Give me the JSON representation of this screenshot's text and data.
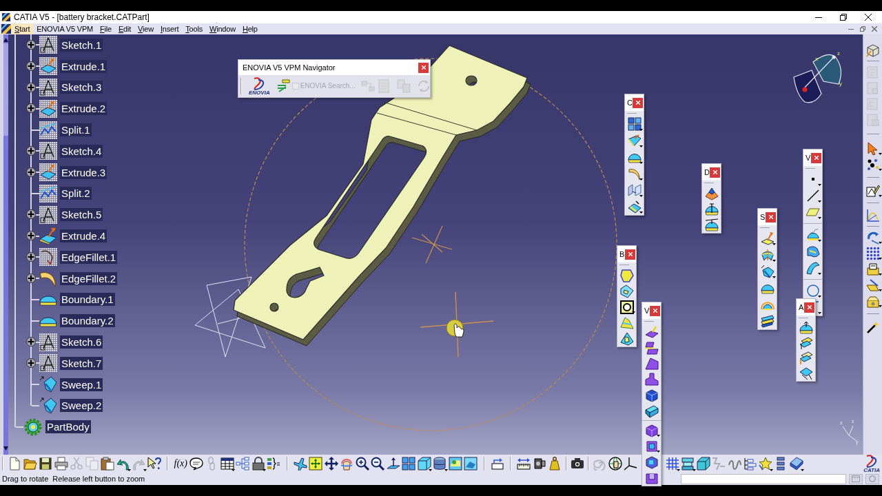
{
  "window": {
    "title": "CATIA V5 - [battery bracket.CATPart]"
  },
  "menu": [
    {
      "label": "Start",
      "selected": true,
      "mnemonic": true
    },
    {
      "label": "ENOVIA V5 VPM",
      "selected": false,
      "mnemonic": false
    },
    {
      "label": "File",
      "selected": false,
      "mnemonic": true
    },
    {
      "label": "Edit",
      "selected": false,
      "mnemonic": true
    },
    {
      "label": "View",
      "selected": false,
      "mnemonic": true
    },
    {
      "label": "Insert",
      "selected": false,
      "mnemonic": true
    },
    {
      "label": "Tools",
      "selected": false,
      "mnemonic": true
    },
    {
      "label": "Window",
      "selected": false,
      "mnemonic": true
    },
    {
      "label": "Help",
      "selected": false,
      "mnemonic": true
    }
  ],
  "tree": [
    {
      "children": [
        {
          "label": "Sketch.1",
          "kind": "sketch",
          "expanded": false
        },
        {
          "label": "Extrude.1",
          "kind": "extrude",
          "expanded": false
        },
        {
          "label": "Sketch.3",
          "kind": "sketch",
          "expanded": false
        },
        {
          "label": "Extrude.2",
          "kind": "extrude",
          "expanded": false
        },
        {
          "label": "Split.1",
          "kind": "split"
        },
        {
          "label": "Sketch.4",
          "kind": "sketch",
          "expanded": false
        },
        {
          "label": "Extrude.3",
          "kind": "extrude",
          "expanded": false
        },
        {
          "label": "Split.2",
          "kind": "split"
        },
        {
          "label": "Sketch.5",
          "kind": "sketch",
          "expanded": false
        },
        {
          "label": "Extrude.4",
          "kind": "extrude_slab",
          "expanded": false
        },
        {
          "label": "EdgeFillet.1",
          "kind": "edge_fillet",
          "expanded": false
        },
        {
          "label": "EdgeFillet.2",
          "kind": "fillet_crescent",
          "expanded": false
        },
        {
          "label": "Boundary.1",
          "kind": "boundary"
        },
        {
          "label": "Boundary.2",
          "kind": "boundary"
        },
        {
          "label": "Sketch.6",
          "kind": "sketch",
          "expanded": false
        },
        {
          "label": "Sketch.7",
          "kind": "sketch",
          "expanded": false
        },
        {
          "label": "Sweep.1",
          "kind": "sweep"
        },
        {
          "label": "Sweep.2",
          "kind": "sweep"
        }
      ]
    },
    {
      "label": "PartBody",
      "kind": "body"
    }
  ],
  "navigator": {
    "title": "ENOVIA V5 VPM Navigator",
    "logo": "ENOVIA",
    "search": {
      "label": "ENOVIA Search...",
      "checked": false,
      "disabled": true
    },
    "buttons": [
      {
        "disabled": false
      },
      {
        "disabled": true
      },
      {
        "disabled": true
      },
      {
        "disabled": true
      },
      {
        "disabled": true
      }
    ]
  },
  "palettes": [
    {
      "title": "C"
    },
    {
      "title": "V"
    },
    {
      "title": "D"
    },
    {
      "title": "S"
    },
    {
      "title": "B"
    },
    {
      "title": "A"
    },
    {
      "title": "V"
    }
  ],
  "compass": {
    "labels": [
      "x",
      "z",
      "y"
    ]
  },
  "triad": {
    "labels": [
      "x",
      "z",
      "y"
    ]
  },
  "right_toolbar": {
    "groups": [
      {
        "buttons": [
          {
            "disabled": false
          }
        ]
      },
      {
        "buttons": [
          {
            "disabled": true
          },
          {
            "disabled": true
          },
          {
            "disabled": true
          },
          {
            "disabled": true
          }
        ]
      },
      {
        "buttons": [
          {
            "disabled": false
          },
          {
            "disabled": false
          }
        ]
      },
      {
        "buttons": [
          {
            "disabled": false
          }
        ]
      },
      {
        "buttons": [
          {
            "disabled": false
          }
        ]
      },
      {
        "buttons": [
          {
            "disabled": false
          },
          {
            "disabled": false
          },
          {
            "disabled": false
          },
          {
            "disabled": false
          },
          {
            "disabled": false
          }
        ]
      },
      {
        "buttons": [
          {
            "disabled": false
          }
        ]
      }
    ]
  },
  "toolbar": {
    "groups": [
      {
        "buttons": [
          {
            "disabled": false
          },
          {
            "disabled": false
          },
          {
            "disabled": false
          },
          {
            "disabled": false
          },
          {
            "disabled": true
          },
          {
            "disabled": true
          },
          {
            "disabled": false
          },
          {
            "disabled": false
          },
          {
            "disabled": true
          },
          {
            "disabled": false
          }
        ]
      },
      {
        "buttons": [
          {
            "label": "f(x)",
            "disabled": false
          },
          {
            "disabled": false
          },
          {
            "disabled": true
          },
          {
            "disabled": false
          },
          {
            "disabled": false
          },
          {
            "disabled": false
          },
          {
            "disabled": false
          }
        ]
      },
      {
        "buttons": [
          {
            "disabled": false
          },
          {
            "disabled": false
          },
          {
            "disabled": false
          },
          {
            "disabled": false
          },
          {
            "disabled": false
          },
          {
            "disabled": false
          },
          {
            "disabled": false
          },
          {
            "disabled": false
          },
          {
            "disabled": false
          },
          {
            "disabled": false
          },
          {
            "disabled": false
          },
          {
            "disabled": false
          }
        ]
      },
      {
        "buttons": [
          {
            "disabled": false
          }
        ]
      },
      {
        "buttons": [
          {
            "disabled": false
          },
          {
            "disabled": false
          },
          {
            "disabled": false
          }
        ]
      },
      {
        "buttons": [
          {
            "disabled": false
          }
        ]
      },
      {
        "buttons": [
          {
            "disabled": true
          },
          {
            "disabled": false
          },
          {
            "disabled": false
          }
        ]
      },
      {
        "buttons": [
          {
            "disabled": false
          },
          {
            "disabled": false
          },
          {
            "disabled": false
          },
          {
            "disabled": true
          },
          {
            "disabled": false
          },
          {
            "disabled": false
          },
          {
            "disabled": false
          },
          {
            "disabled": false
          },
          {
            "disabled": false
          }
        ]
      }
    ]
  },
  "brand": {
    "logo": "CATIA"
  },
  "status_bar": {
    "message": "Drag to rotate  Release left button to zoom"
  }
}
